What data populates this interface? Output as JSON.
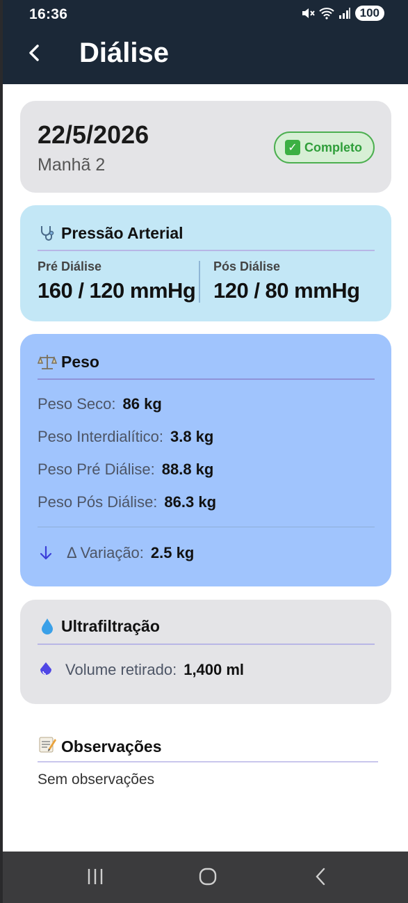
{
  "status_bar": {
    "time": "16:36",
    "battery": "100"
  },
  "header": {
    "title": "Diálise"
  },
  "session": {
    "date": "22/5/2026",
    "shift": "Manhã 2",
    "status": "Completo"
  },
  "blood_pressure": {
    "title": "Pressão Arterial",
    "pre_label": "Pré Diálise",
    "pre_value": "160 / 120 mmHg",
    "post_label": "Pós Diálise",
    "post_value": "120 / 80 mmHg"
  },
  "weight": {
    "title": "Peso",
    "rows": [
      {
        "label": "Peso Seco:",
        "value": "86 kg"
      },
      {
        "label": "Peso Interdialítico:",
        "value": "3.8 kg"
      },
      {
        "label": "Peso Pré Diálise:",
        "value": "88.8 kg"
      },
      {
        "label": "Peso Pós Diálise:",
        "value": "86.3 kg"
      }
    ],
    "variation_label": "Δ Variação:",
    "variation_value": "2.5 kg"
  },
  "ultrafiltration": {
    "title": "Ultrafiltração",
    "label": "Volume retirado:",
    "value": "1,400 ml"
  },
  "observations": {
    "title": "Observações",
    "text": "Sem observações"
  },
  "colors": {
    "header_bg": "#1b2837",
    "pressure_card": "#c3e7f6",
    "weight_card": "#a0c4fd",
    "neutral_card": "#e4e4e7",
    "status_green": "#2f9e3a",
    "accent_purple": "#4f46e5"
  },
  "icons": [
    "back-arrow-icon",
    "stethoscope-icon",
    "scale-icon",
    "arrow-down-icon",
    "water-drop-icon",
    "drop-icon",
    "memo-icon",
    "check-icon",
    "recents-icon",
    "home-icon",
    "nav-back-icon"
  ]
}
